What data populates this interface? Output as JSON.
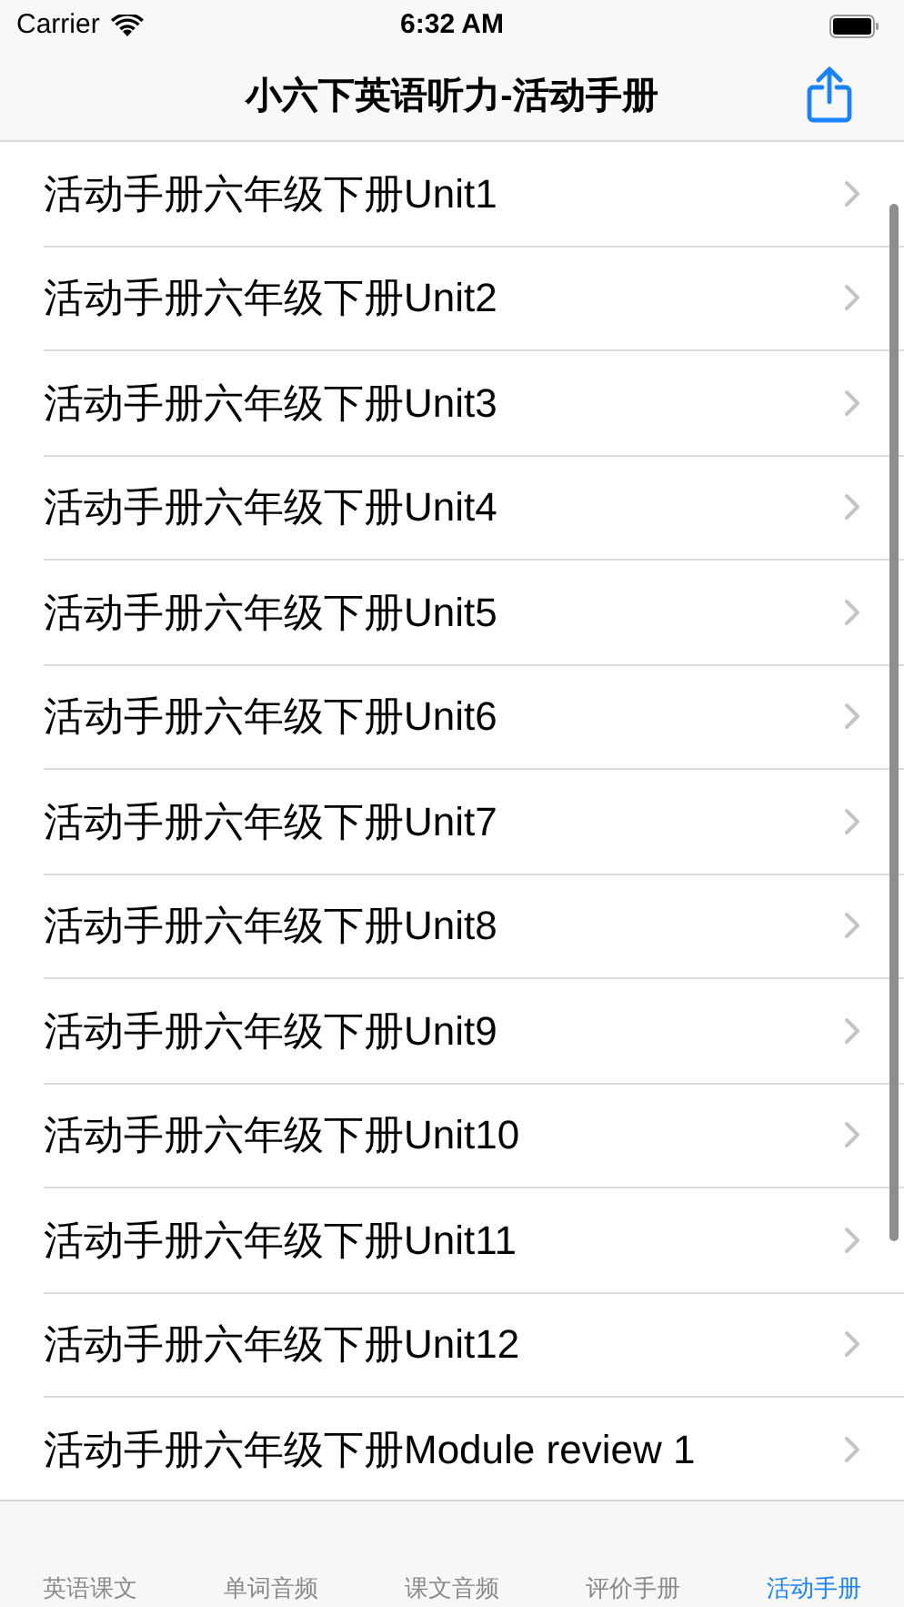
{
  "status_bar": {
    "carrier": "Carrier",
    "time": "6:32 AM"
  },
  "nav": {
    "title": "小六下英语听力-活动手册"
  },
  "list": {
    "items": [
      {
        "label": "活动手册六年级下册Unit1"
      },
      {
        "label": "活动手册六年级下册Unit2"
      },
      {
        "label": "活动手册六年级下册Unit3"
      },
      {
        "label": "活动手册六年级下册Unit4"
      },
      {
        "label": "活动手册六年级下册Unit5"
      },
      {
        "label": "活动手册六年级下册Unit6"
      },
      {
        "label": "活动手册六年级下册Unit7"
      },
      {
        "label": "活动手册六年级下册Unit8"
      },
      {
        "label": "活动手册六年级下册Unit9"
      },
      {
        "label": "活动手册六年级下册Unit10"
      },
      {
        "label": "活动手册六年级下册Unit11"
      },
      {
        "label": "活动手册六年级下册Unit12"
      },
      {
        "label": "活动手册六年级下册Module review 1"
      }
    ]
  },
  "tab_bar": {
    "tabs": [
      {
        "label": "英语课文",
        "selected": false
      },
      {
        "label": "单词音频",
        "selected": false
      },
      {
        "label": "课文音频",
        "selected": false
      },
      {
        "label": "评价手册",
        "selected": false
      },
      {
        "label": "活动手册",
        "selected": true
      }
    ]
  }
}
